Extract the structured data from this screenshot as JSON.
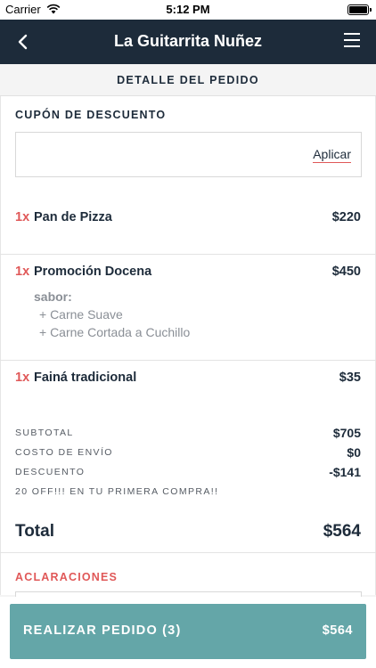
{
  "status_bar": {
    "carrier": "Carrier",
    "time": "5:12 PM"
  },
  "nav": {
    "title": "La Guitarrita Nuñez"
  },
  "section": {
    "title": "DETALLE DEL PEDIDO"
  },
  "coupon": {
    "label": "CUPÓN DE DESCUENTO",
    "value": "",
    "apply_label": "Aplicar"
  },
  "items": [
    {
      "qty": "1x",
      "name": "Pan de Pizza",
      "price": "$220"
    },
    {
      "qty": "1x",
      "name": "Promoción Docena",
      "price": "$450",
      "modifier_label": "sabor:",
      "modifiers": [
        "+ Carne Suave",
        "+ Carne Cortada a Cuchillo"
      ]
    },
    {
      "qty": "1x",
      "name": "Fainá tradicional",
      "price": "$35"
    }
  ],
  "summary": {
    "subtotal_label": "SUBTOTAL",
    "subtotal": "$705",
    "shipping_label": "COSTO DE ENVÍO",
    "shipping": "$0",
    "discount_label": "DESCUENTO",
    "discount": "-$141",
    "promo_note": "20 OFF!!! EN TU PRIMERA COMPRA!!",
    "total_label": "Total",
    "total": "$564"
  },
  "notes": {
    "label": "ACLARACIONES"
  },
  "order_button": {
    "label": "REALIZAR PEDIDO (3)",
    "price": "$564"
  },
  "colors": {
    "navy": "#1d2b3a",
    "accent_red": "#e05858",
    "button_teal": "#64a6a8"
  }
}
